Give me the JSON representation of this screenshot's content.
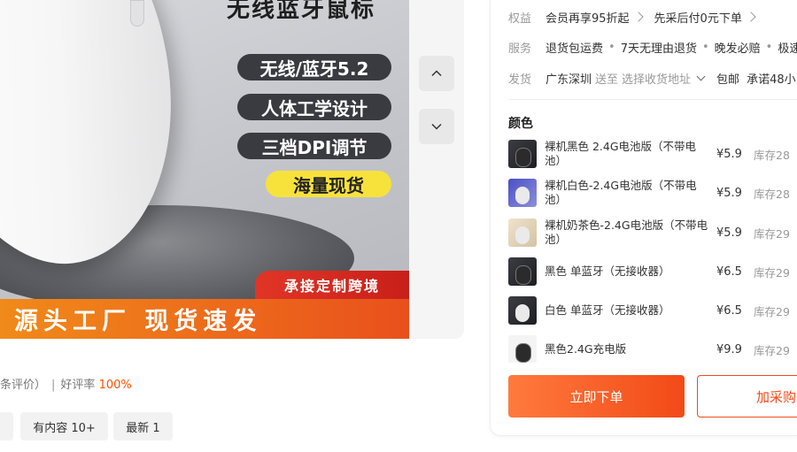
{
  "gallery": {
    "headline": "无线蓝牙鼠标",
    "features": [
      "无线/蓝牙5.2",
      "人体工学设计",
      "三档DPI调节",
      "海量现货"
    ],
    "promo_tag": "承接定制跨境",
    "bottom_banner": "源头工厂 现货速发",
    "up_icon": "chevron-up-icon",
    "down_icon": "chevron-down-icon"
  },
  "reviews": {
    "count_suffix": "条评价）",
    "separator": "|",
    "rate_label": "好评率",
    "rate_value": "100%",
    "filters": [
      "",
      "有内容 10+",
      "最新 1"
    ]
  },
  "offer": {
    "benefits_label": "权益",
    "benefit_1": "会员再享95折起",
    "benefit_2": "先采后付0元下单",
    "service_label": "服务",
    "services": [
      "退货包运费",
      "7天无理由退货",
      "晚发必赔",
      "极速"
    ],
    "ship_label": "发货",
    "ship_from": "广东深圳",
    "ship_to_prefix": "送至",
    "ship_to": "选择收货地址",
    "free_ship": "包邮",
    "promise": "承诺48小"
  },
  "variants": {
    "title": "颜色",
    "items": [
      {
        "name": "裸机黑色 2.4G电池版（不带电池）",
        "price": "¥5.9",
        "stock": "库存28"
      },
      {
        "name": "裸机白色-2.4G电池版（不带电池）",
        "price": "¥5.9",
        "stock": "库存28"
      },
      {
        "name": "裸机奶茶色-2.4G电池版（不带电池）",
        "price": "¥5.9",
        "stock": "库存29"
      },
      {
        "name": "黑色 单蓝牙（无接收器）",
        "price": "¥6.5",
        "stock": "库存29"
      },
      {
        "name": "白色 单蓝牙（无接收器）",
        "price": "¥6.5",
        "stock": "库存29"
      },
      {
        "name": "黑色2.4G充电版",
        "price": "¥9.9",
        "stock": "库存29"
      }
    ]
  },
  "actions": {
    "buy_now": "立即下单",
    "add_cart": "加采购"
  },
  "colors": {
    "accent": "#ff5000",
    "button_gradient_start": "#ff7a3d",
    "button_gradient_end": "#f24a17"
  }
}
